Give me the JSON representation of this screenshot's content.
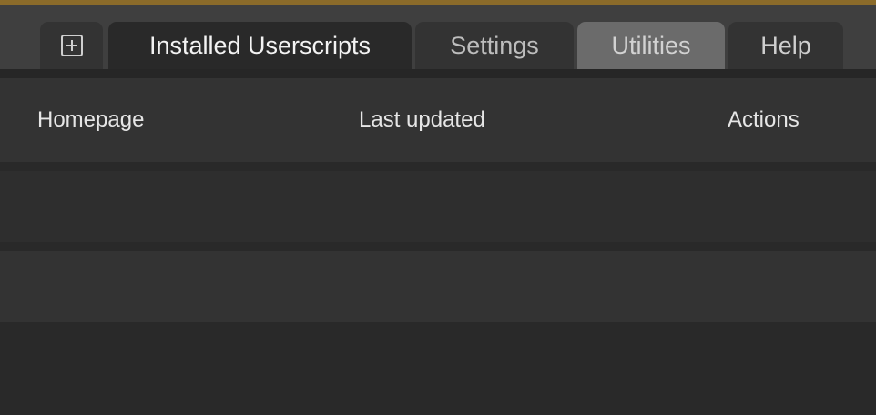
{
  "tabs": {
    "add_icon": "plus-box-icon",
    "installed": "Installed Userscripts",
    "settings": "Settings",
    "utilities": "Utilities",
    "help": "Help"
  },
  "table": {
    "columns": [
      "Homepage",
      "Last updated",
      "Actions"
    ],
    "rows": [
      {
        "homepage": "",
        "last_updated": "",
        "actions": ""
      },
      {
        "homepage": "",
        "last_updated": "",
        "actions": ""
      }
    ]
  },
  "colors": {
    "accent_bar": "#8b6b2a",
    "background": "#292929",
    "active_tab": "#292929",
    "highlight_tab": "#6b6b6b"
  }
}
